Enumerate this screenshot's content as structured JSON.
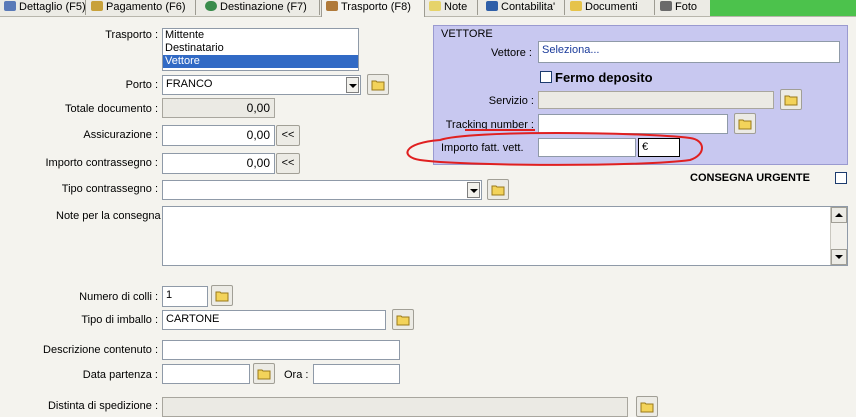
{
  "tabs": [
    {
      "label": "Dettaglio (F5)",
      "icon": "document-icon",
      "color": "#5a7ab8"
    },
    {
      "label": "Pagamento (F6)",
      "icon": "money-icon",
      "color": "#c8a13a"
    },
    {
      "label": "Destinazione (F7)",
      "icon": "globe-icon",
      "color": "#3a8c4c"
    },
    {
      "label": "Trasporto (F8)",
      "icon": "truck-icon",
      "color": "#b07a3a"
    },
    {
      "label": "Note",
      "icon": "note-icon",
      "color": "#e6d36a"
    },
    {
      "label": "Contabilita'",
      "icon": "book-icon",
      "color": "#2f5fa8"
    },
    {
      "label": "Documenti",
      "icon": "documents-icon",
      "color": "#e6c34a"
    },
    {
      "label": "Foto",
      "icon": "camera-icon",
      "color": "#6a6a6a"
    }
  ],
  "form": {
    "trasporto_label": "Trasporto :",
    "trasporto_options": [
      "Mittente",
      "Destinatario",
      "Vettore"
    ],
    "trasporto_selected": "Vettore",
    "porto_label": "Porto :",
    "porto_value": "FRANCO",
    "totale_label": "Totale documento :",
    "totale_value": "0,00",
    "assicurazione_label": "Assicurazione :",
    "assicurazione_value": "0,00",
    "contrassegno_label": "Importo contrassegno :",
    "contrassegno_value": "0,00",
    "shift_label": "<<",
    "tipo_contrassegno_label": "Tipo contrassegno :",
    "tipo_contrassegno_value": "",
    "note_label": "Note per la consegna",
    "note_value": "",
    "colli_label": "Numero di colli :",
    "colli_value": "1",
    "imballo_label": "Tipo di imballo :",
    "imballo_value": "CARTONE",
    "descrizione_label": "Descrizione contenuto :",
    "descrizione_value": "",
    "data_partenza_label": "Data partenza :",
    "data_partenza_value": "",
    "ora_label": "Ora :",
    "ora_value": "",
    "distinta_label": "Distinta di spedizione :",
    "distinta_value": ""
  },
  "vettore": {
    "title": "VETTORE",
    "vettore_label": "Vettore :",
    "vettore_value": "Seleziona...",
    "fermo_deposito_label": "Fermo deposito",
    "servizio_label": "Servizio :",
    "servizio_value": "",
    "tracking_label": "Tracking number :",
    "tracking_value": "",
    "importo_label": "Importo fatt. vett.",
    "importo_value": "",
    "currency": "€"
  },
  "consegna_urgente_label": "CONSEGNA URGENTE",
  "colors": {
    "accent_green": "#4cc24c",
    "vettore_panel": "#c8c8f0",
    "selection": "#316ac5",
    "annotation_red": "#e02020"
  }
}
